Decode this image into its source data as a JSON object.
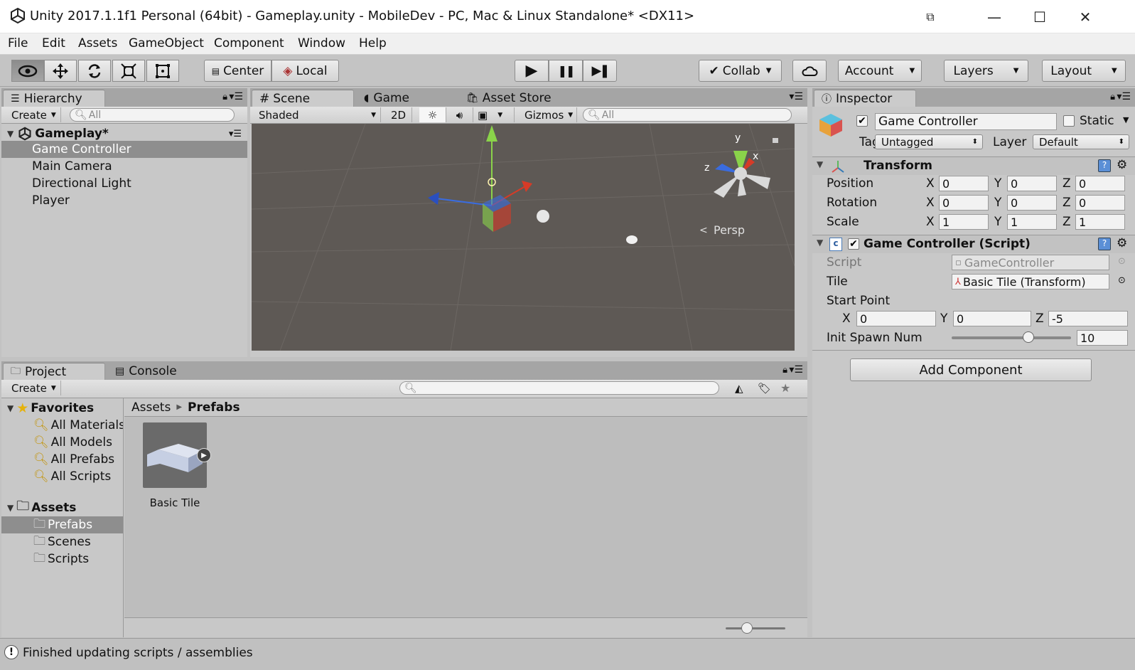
{
  "window": {
    "title": "Unity 2017.1.1f1 Personal (64bit) - Gameplay.unity - MobileDev - PC, Mac & Linux Standalone* <DX11>",
    "controls": {
      "minimize": "—",
      "maximize": "☐",
      "close": "✕"
    }
  },
  "menu": [
    "File",
    "Edit",
    "Assets",
    "GameObject",
    "Component",
    "Window",
    "Help"
  ],
  "toolbar": {
    "pivot": "Center",
    "space": "Local",
    "collab": "Collab",
    "account": "Account",
    "layers": "Layers",
    "layout": "Layout",
    "play": "▶",
    "pause": "❚❚",
    "step": "▶❚"
  },
  "hierarchy": {
    "tab": "Hierarchy",
    "create": "Create",
    "search_placeholder": "All",
    "scene": "Gameplay*",
    "items": [
      "Game Controller",
      "Main Camera",
      "Directional Light",
      "Player"
    ],
    "selected_index": 0
  },
  "scene": {
    "tabs": [
      "Scene",
      "Game",
      "Asset Store"
    ],
    "shading": "Shaded",
    "mode_2d": "2D",
    "gizmos": "Gizmos",
    "search_placeholder": "All",
    "gizmo_axes": {
      "y": "y",
      "x": "x",
      "z": "z"
    },
    "projection": "Persp"
  },
  "project": {
    "tabs": [
      "Project",
      "Console"
    ],
    "create": "Create",
    "favorites_label": "Favorites",
    "favorites": [
      "All Materials",
      "All Models",
      "All Prefabs",
      "All Scripts"
    ],
    "assets_label": "Assets",
    "folders": [
      "Prefabs",
      "Scenes",
      "Scripts"
    ],
    "selected_folder": "Prefabs",
    "breadcrumb": [
      "Assets",
      "Prefabs"
    ],
    "items": [
      {
        "name": "Basic Tile"
      }
    ]
  },
  "inspector": {
    "tab": "Inspector",
    "object_name": "Game Controller",
    "active": true,
    "static_label": "Static",
    "tag_label": "Tag",
    "tag": "Untagged",
    "layer_label": "Layer",
    "layer": "Default",
    "transform": {
      "title": "Transform",
      "position_label": "Position",
      "rotation_label": "Rotation",
      "scale_label": "Scale",
      "position": {
        "x": "0",
        "y": "0",
        "z": "0"
      },
      "rotation": {
        "x": "0",
        "y": "0",
        "z": "0"
      },
      "scale": {
        "x": "1",
        "y": "1",
        "z": "1"
      }
    },
    "script_component": {
      "title": "Game Controller (Script)",
      "enabled": true,
      "script_label": "Script",
      "script_value": "GameController",
      "tile_label": "Tile",
      "tile_value": "Basic Tile (Transform)",
      "start_point_label": "Start Point",
      "start_point": {
        "x": "0",
        "y": "0",
        "z": "-5"
      },
      "init_spawn_label": "Init Spawn Num",
      "init_spawn_value": "10",
      "init_spawn_slider_fraction": 0.64
    },
    "add_component": "Add Component",
    "axis_labels": {
      "x": "X",
      "y": "Y",
      "z": "Z"
    }
  },
  "status": {
    "message": "Finished updating scripts / assemblies"
  }
}
